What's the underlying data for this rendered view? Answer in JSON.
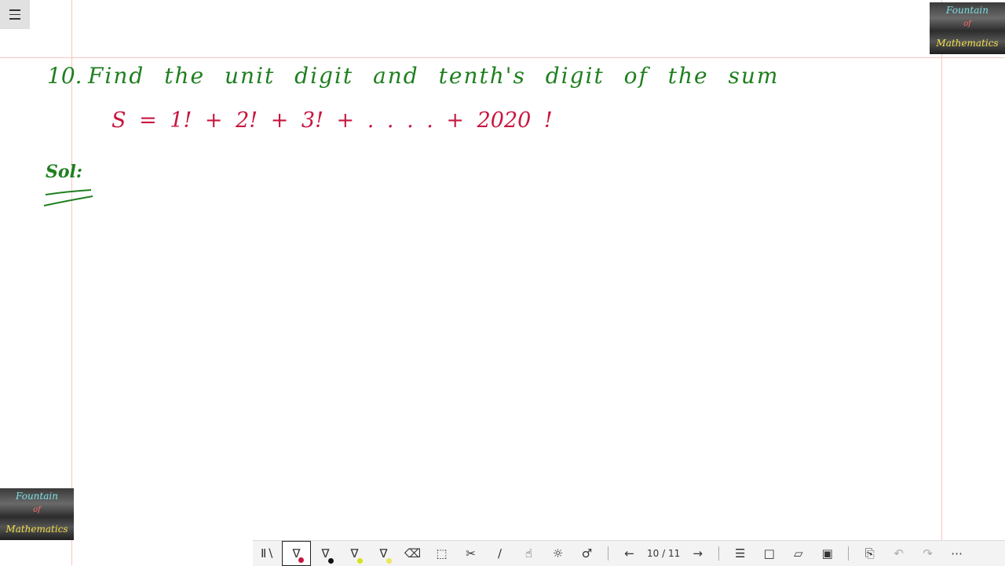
{
  "app": {
    "menu_icon": "hamburger-icon"
  },
  "logos": [
    {
      "line1": "Fountain",
      "line2": "of",
      "line3": "Mathematics"
    },
    {
      "line1": "Fountain",
      "line2": "of",
      "line3": "Mathematics"
    }
  ],
  "note": {
    "question_number": "10.",
    "question_text": "Find the unit digit and tenth's digit of the sum",
    "equation": "S = 1! + 2! + 3! + . . . . + 2020 !",
    "solution_label": "Sol:"
  },
  "toolbar": {
    "tools": [
      {
        "icon": "library-icon",
        "glyph": "Ⅱ∖"
      },
      {
        "icon": "pen-red-icon",
        "glyph": "∇",
        "dot_color": "#c8163f"
      },
      {
        "icon": "pen-black-icon",
        "glyph": "∇",
        "dot_color": "#111111"
      },
      {
        "icon": "highlighter-yellow-icon",
        "glyph": "∇",
        "dot_color": "#d7e21a"
      },
      {
        "icon": "highlighter-yellow2-icon",
        "glyph": "∇",
        "dot_color": "#e8e85a"
      },
      {
        "icon": "eraser-icon",
        "glyph": "⌫"
      },
      {
        "icon": "lasso-select-icon",
        "glyph": "⬚"
      },
      {
        "icon": "attach-icon",
        "glyph": "✂"
      },
      {
        "icon": "ruler-icon",
        "glyph": "∕"
      },
      {
        "icon": "touch-draw-icon",
        "glyph": "☝"
      },
      {
        "icon": "palette-icon",
        "glyph": "☼"
      },
      {
        "icon": "microphone-icon",
        "glyph": "♂"
      }
    ],
    "prev_icon": "arrow-left-icon",
    "next_icon": "arrow-right-icon",
    "page_indicator": "10 / 11",
    "right_tools": [
      {
        "icon": "settings-sliders-icon",
        "glyph": "☰"
      },
      {
        "icon": "new-page-icon",
        "glyph": "□"
      },
      {
        "icon": "open-folder-icon",
        "glyph": "▱"
      },
      {
        "icon": "save-icon",
        "glyph": "▣"
      },
      {
        "icon": "paste-icon",
        "glyph": "⎘"
      },
      {
        "icon": "undo-icon",
        "glyph": "↶"
      },
      {
        "icon": "redo-icon",
        "glyph": "↷"
      },
      {
        "icon": "more-icon",
        "glyph": "⋯"
      }
    ]
  }
}
